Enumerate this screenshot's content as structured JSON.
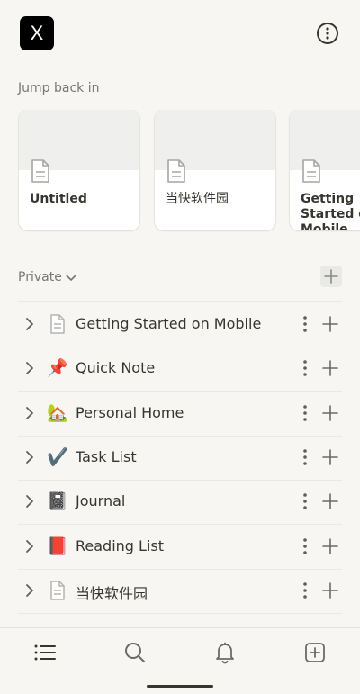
{
  "workspace": {
    "initial": "X"
  },
  "jump_back": {
    "label": "Jump back in",
    "cards": [
      {
        "title": "Untitled"
      },
      {
        "title": "当快软件园"
      },
      {
        "title": "Getting Started on Mobile"
      }
    ]
  },
  "private": {
    "label": "Private",
    "pages": [
      {
        "label": "Getting Started on Mobile",
        "icon": "document-icon",
        "emoji": ""
      },
      {
        "label": "Quick Note",
        "icon": "pushpin-icon",
        "emoji": "📌"
      },
      {
        "label": "Personal Home",
        "icon": "house-icon",
        "emoji": "🏡"
      },
      {
        "label": "Task List",
        "icon": "checkmark-icon",
        "emoji": "✔️"
      },
      {
        "label": "Journal",
        "icon": "notebook-icon",
        "emoji": "📓"
      },
      {
        "label": "Reading List",
        "icon": "red-book-icon",
        "emoji": "📕"
      },
      {
        "label": "当快软件园",
        "icon": "document-icon",
        "emoji": ""
      }
    ]
  },
  "bottom_nav": [
    "home-list-icon",
    "search-icon",
    "bell-icon",
    "new-page-icon"
  ],
  "colors": {
    "background": "#f7f6f3",
    "text": "#37352f",
    "muted": "#787774",
    "card": "#ffffff"
  }
}
